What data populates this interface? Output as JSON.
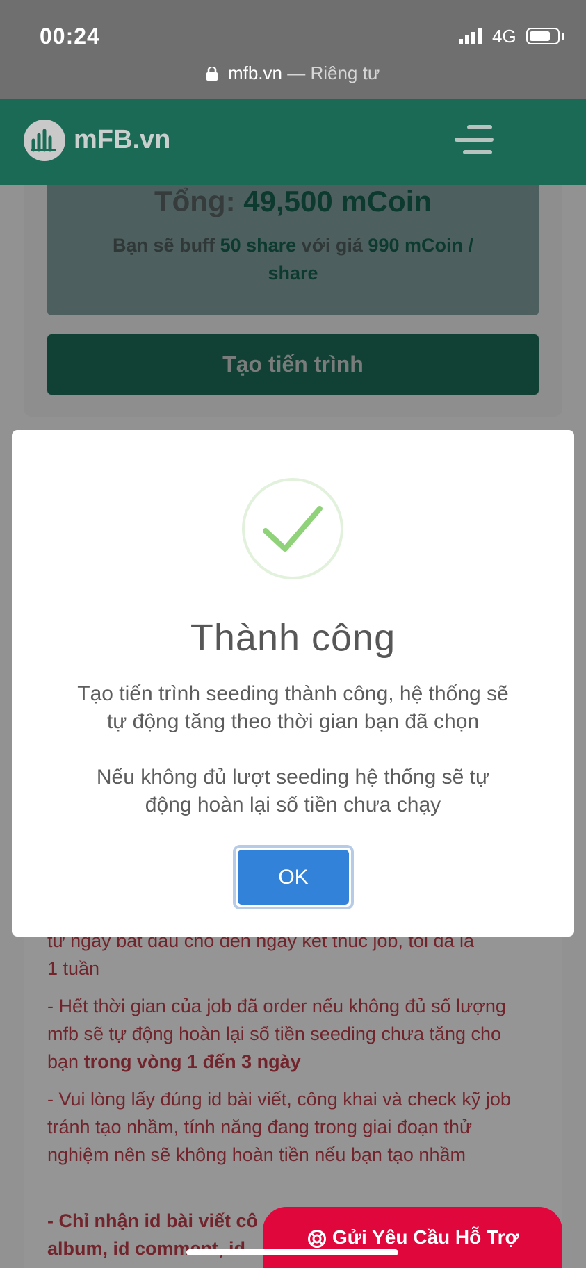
{
  "status_bar": {
    "time": "00:24",
    "network": "4G",
    "battery": 0.75
  },
  "url_bar": {
    "domain": "mfb.vn",
    "privacy": "— Riêng tư"
  },
  "header": {
    "logo_text": "mFB.vn"
  },
  "summary": {
    "total_label": "Tổng:",
    "total_amount": "49,500 mCoin",
    "buff_pre": "Bạn sẽ buff",
    "buff_count": "50 share",
    "buff_mid": "với giá",
    "buff_price": "990 mCoin /",
    "buff_unit": "share"
  },
  "create_button": "Tạo tiến trình",
  "modal": {
    "title": "Thành công",
    "message_1_line_1": "Tạo tiến trình seeding thành công, hệ thống sẽ",
    "message_1_line_2": "tự động tăng theo thời gian bạn đã chọn",
    "message_2_line_1": "Nếu không đủ lượt seeding hệ thống sẽ tự",
    "message_2_line_2": "động hoàn lại số tiền chưa chạy",
    "ok_label": "OK"
  },
  "notes": {
    "line_1": "từ ngày bắt đầu cho đến ngày kết thúc job, tối đa là",
    "line_2": "1 tuần",
    "note_2_text": "- Hết thời gian của job đã order nếu không đủ số lượng mfb sẽ tự động hoàn lại số tiền seeding chưa tăng cho bạn",
    "note_2_bold": "trong vòng 1 đến 3 ngày",
    "note_3_text": "- Vui lòng lấy đúng id bài viết, công khai và check kỹ job tránh tạo nhầm, tính năng đang trong giai đoạn thử nghiệm nên sẽ không hoàn tiền nếu bạn tạo nhầm",
    "note_4_line_1": "- Chỉ nhận id bài viết cô",
    "note_4_line_2": "album, id comment, id"
  },
  "support_button": "Gửi Yêu Cầu Hỗ Trợ"
}
